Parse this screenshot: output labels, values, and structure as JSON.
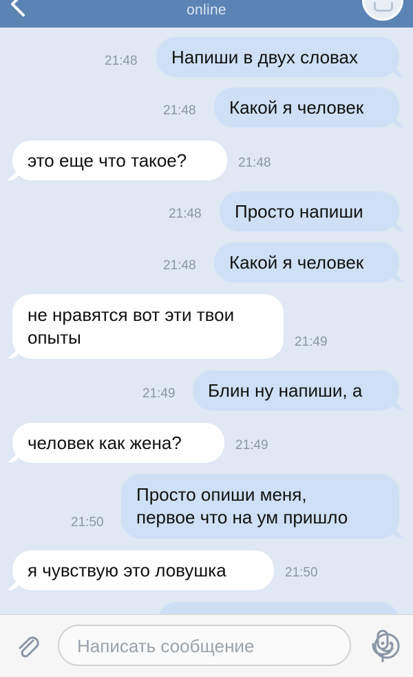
{
  "header": {
    "status": "online"
  },
  "messages": [
    {
      "dir": "out",
      "lines": [
        "Напиши в двух словах"
      ],
      "time": "21:48"
    },
    {
      "dir": "out",
      "lines": [
        "Какой я человек"
      ],
      "time": "21:48"
    },
    {
      "dir": "in",
      "lines": [
        "это еще что такое?"
      ],
      "time": "21:48"
    },
    {
      "dir": "out",
      "lines": [
        "Просто напиши"
      ],
      "time": "21:48"
    },
    {
      "dir": "out",
      "lines": [
        "Какой я человек"
      ],
      "time": "21:48"
    },
    {
      "dir": "in",
      "lines": [
        "не нравятся вот эти твои",
        "опыты"
      ],
      "time": "21:49"
    },
    {
      "dir": "out",
      "lines": [
        "Блин ну напиши, а"
      ],
      "time": "21:49"
    },
    {
      "dir": "in",
      "lines": [
        "человек как жена?"
      ],
      "time": "21:49"
    },
    {
      "dir": "out",
      "lines": [
        "Просто опиши меня,",
        "первое что на ум пришло"
      ],
      "time": "21:50"
    },
    {
      "dir": "in",
      "lines": [
        "я чувствую это ловушка"
      ],
      "time": "21:50"
    },
    {
      "dir": "out",
      "lines": [
        ""
      ],
      "time": ""
    }
  ],
  "composer": {
    "placeholder": "Написать сообщение"
  },
  "icons": {
    "back": "back-chevron-icon",
    "avatar": "camera-icon",
    "attach": "paperclip-icon",
    "emoji": "smile-icon",
    "mic": "microphone-icon"
  },
  "colors": {
    "header": "#5b83b4",
    "chat_background": "#dfe8f3",
    "outgoing_bubble": "#cfdff5",
    "incoming_bubble": "#ffffff"
  }
}
